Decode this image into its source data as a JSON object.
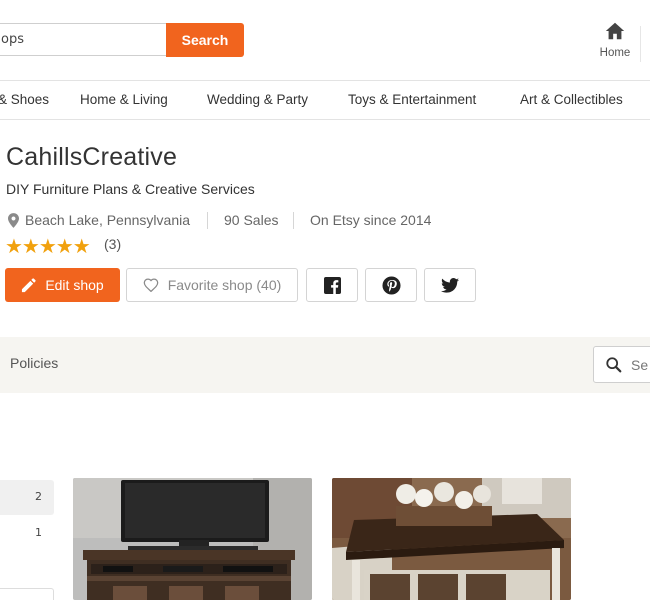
{
  "header": {
    "search_value": "ops",
    "search_button": "Search",
    "home_label": "Home"
  },
  "categories": [
    "& Shoes",
    "Home & Living",
    "Wedding & Party",
    "Toys & Entertainment",
    "Art & Collectibles"
  ],
  "shop": {
    "name": "CahillsCreative",
    "tagline": "DIY Furniture Plans & Creative Services",
    "location": "Beach Lake, Pennsylvania",
    "sales": "90 Sales",
    "since": "On Etsy since 2014",
    "rating": 5,
    "stars": "★★★★★",
    "review_count": "(3)",
    "edit_button": "Edit shop",
    "favorite_button": "Favorite shop (40)"
  },
  "social": [
    "facebook-icon",
    "pinterest-icon",
    "twitter-icon"
  ],
  "section_bar": {
    "policies": "Policies",
    "search_placeholder": "Se"
  },
  "sidebar_counts": [
    "2",
    "1"
  ],
  "colors": {
    "accent": "#f1641e",
    "star": "#f1a10e",
    "section_bg": "#f6f5f1"
  }
}
